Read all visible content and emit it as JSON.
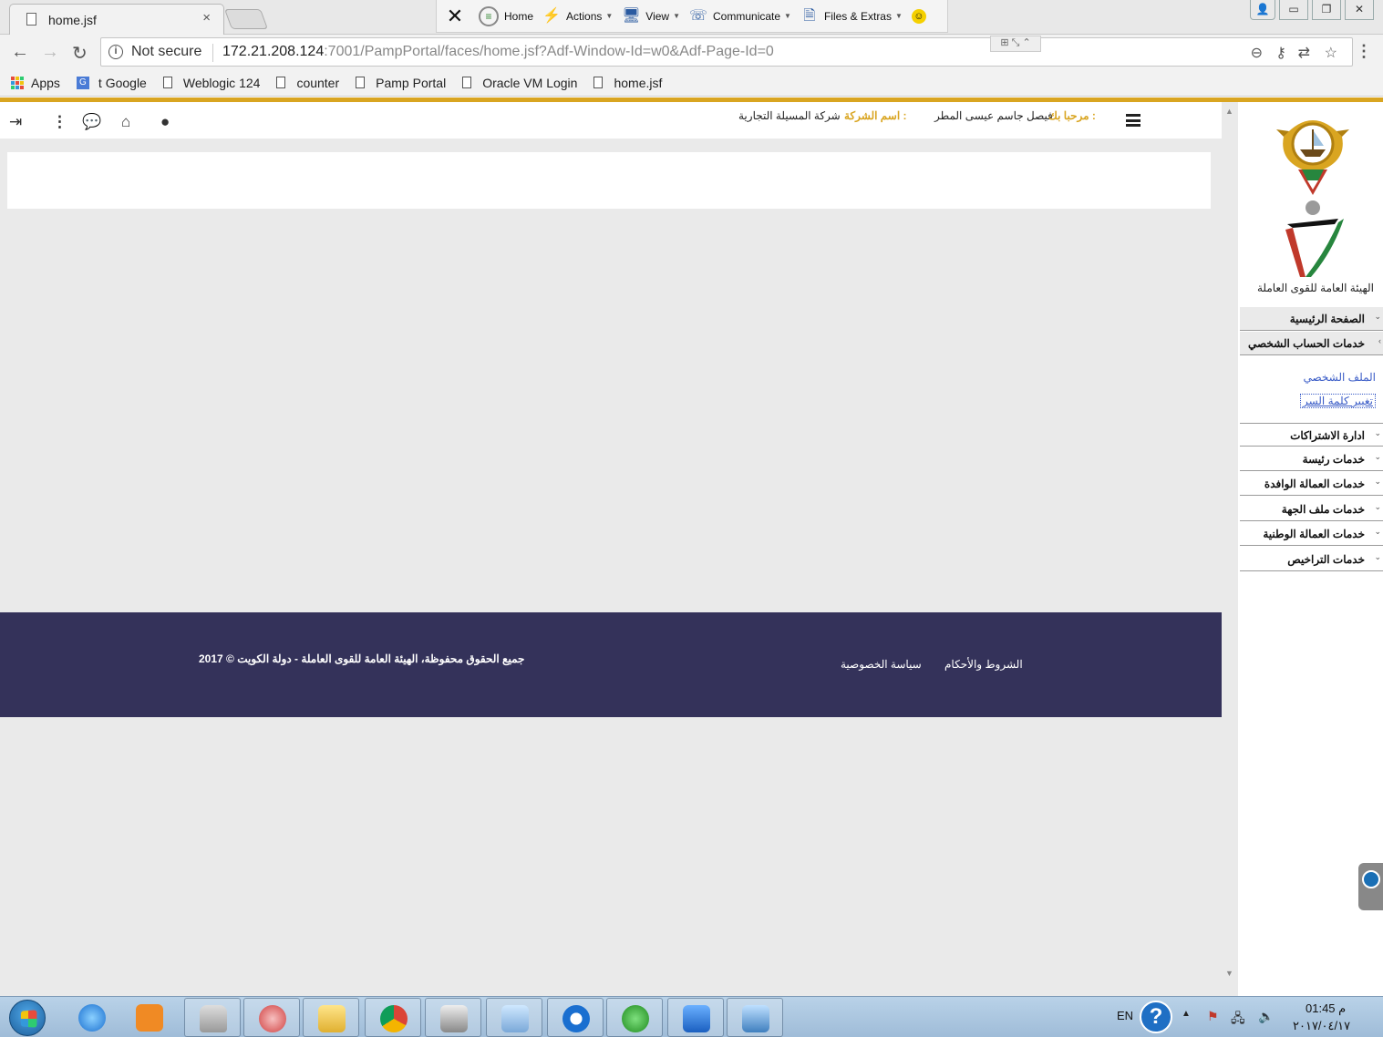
{
  "browser": {
    "tab_title": "home.jsf",
    "tab_close": "×",
    "security_label": "Not secure",
    "url_host": "172.21.208.124",
    "url_rest": ":7001/PampPortal/faces/home.jsf?Adf-Window-Id=w0&Adf-Page-Id=0",
    "bookmarks": [
      "Apps",
      "t Google",
      "Weblogic 124",
      "counter",
      "Pamp Portal",
      "Oracle VM Login",
      "home.jsf"
    ]
  },
  "teamviewer": {
    "items": [
      "Home",
      "Actions",
      "View",
      "Communicate",
      "Files & Extras"
    ]
  },
  "header": {
    "welcome_label": "مرحبا بك :",
    "welcome_value": "فيصل جاسم عيسى المطر",
    "company_label": "اسم الشركة :",
    "company_value": "شركة المسيلة التجارية"
  },
  "sidebar": {
    "org_name": "الهيئة العامة للقوى العاملة",
    "menu": [
      {
        "label": "الصفحة الرئيسية"
      },
      {
        "label": "خدمات الحساب الشخصي"
      },
      {
        "label": "ادارة الاشتراكات"
      },
      {
        "label": "خدمات رئيسة"
      },
      {
        "label": "خدمات العمالة الوافدة"
      },
      {
        "label": "خدمات ملف الجهة"
      },
      {
        "label": "خدمات العمالة الوطنية"
      },
      {
        "label": "خدمات التراخيص"
      }
    ],
    "sub_links": [
      "الملف الشخصي",
      "تغيير كلمة السر"
    ]
  },
  "footer": {
    "copyright": "جميع الحقوق محفوظة، الهيئة العامة للقوى العاملة - دولة الكويت © 2017",
    "privacy": "سياسة الخصوصية",
    "terms": "الشروط والأحكام"
  },
  "taskbar": {
    "language": "EN",
    "time": "01:45 م",
    "date": "٢٠١٧/٠٤/١٧"
  },
  "colors": {
    "gold": "#d9a521",
    "footer_bg": "#34325a",
    "link_blue": "#3a5cc7"
  }
}
